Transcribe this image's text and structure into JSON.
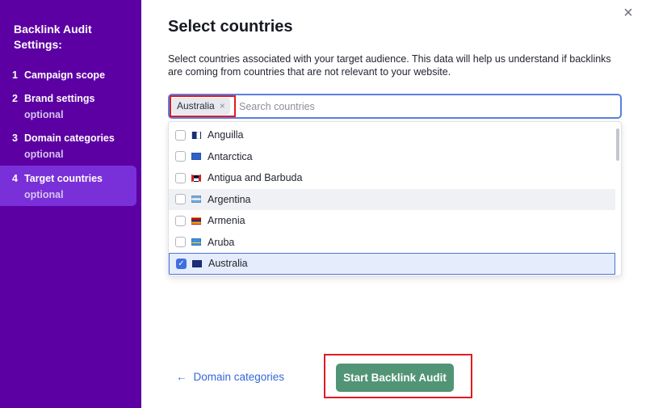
{
  "sidebar": {
    "title": "Backlink Audit Settings:",
    "steps": [
      {
        "num": "1",
        "label": "Campaign scope",
        "sub": ""
      },
      {
        "num": "2",
        "label": "Brand settings",
        "sub": "optional"
      },
      {
        "num": "3",
        "label": "Domain categories",
        "sub": "optional"
      },
      {
        "num": "4",
        "label": "Target countries",
        "sub": "optional"
      }
    ],
    "active_step": 4,
    "bg_color": "#5c00a3",
    "active_color": "#7a30d8"
  },
  "dialog": {
    "heading": "Select countries",
    "description": "Select countries associated with your target audience. This data will help us understand if backlinks are coming from countries that are not relevant to your website.",
    "close_icon": "×"
  },
  "search": {
    "selected_tags": [
      "Australia"
    ],
    "tag_remove_icon": "×",
    "placeholder": "Search countries",
    "value": ""
  },
  "countries": [
    {
      "name": "Anguilla",
      "checked": false,
      "icon": "flag-anguilla-icon"
    },
    {
      "name": "Antarctica",
      "checked": false,
      "icon": "flag-antarctica-icon"
    },
    {
      "name": "Antigua and Barbuda",
      "checked": false,
      "icon": "flag-antigua-icon"
    },
    {
      "name": "Argentina",
      "checked": false,
      "icon": "flag-argentina-icon",
      "hover": true
    },
    {
      "name": "Armenia",
      "checked": false,
      "icon": "flag-armenia-icon"
    },
    {
      "name": "Aruba",
      "checked": false,
      "icon": "flag-aruba-icon"
    },
    {
      "name": "Australia",
      "checked": true,
      "icon": "flag-australia-icon"
    }
  ],
  "footer": {
    "back_arrow": "←",
    "back_label": "Domain categories",
    "start_label": "Start Backlink Audit",
    "start_color": "#519476"
  }
}
